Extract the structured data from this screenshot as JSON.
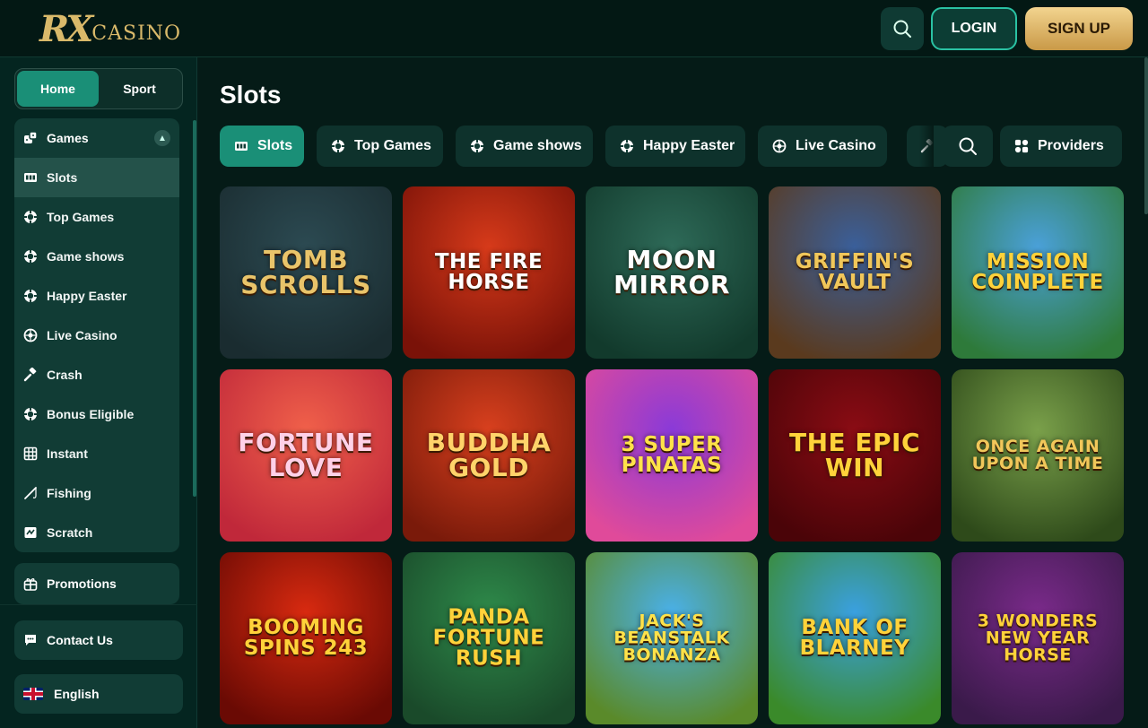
{
  "header": {
    "logo_rx": "RX",
    "logo_casino": "CASINO",
    "search_icon": "search-icon",
    "login_label": "LOGIN",
    "signup_label": "SIGN UP"
  },
  "sidebar": {
    "tabs": [
      {
        "label": "Home",
        "active": true
      },
      {
        "label": "Sport",
        "active": false
      }
    ],
    "games_section": {
      "label": "Games",
      "icon": "dice-icon",
      "expanded": true
    },
    "items": [
      {
        "label": "Slots",
        "icon": "slot-machine-icon",
        "active": true
      },
      {
        "label": "Top Games",
        "icon": "chip-icon"
      },
      {
        "label": "Game shows",
        "icon": "chip-icon"
      },
      {
        "label": "Happy Easter",
        "icon": "chip-icon"
      },
      {
        "label": "Live Casino",
        "icon": "roulette-icon"
      },
      {
        "label": "Crash",
        "icon": "hammer-icon"
      },
      {
        "label": "Bonus Eligible",
        "icon": "chip-icon"
      },
      {
        "label": "Instant",
        "icon": "grid-icon"
      },
      {
        "label": "Fishing",
        "icon": "fishing-rod-icon"
      },
      {
        "label": "Scratch",
        "icon": "scratch-icon"
      }
    ],
    "promotions_label": "Promotions",
    "contact_label": "Contact Us",
    "language_label": "English"
  },
  "main": {
    "title": "Slots",
    "chips": [
      {
        "label": "Slots",
        "icon": "slot-machine-icon",
        "active": true
      },
      {
        "label": "Top Games",
        "icon": "chip-icon"
      },
      {
        "label": "Game shows",
        "icon": "chip-icon"
      },
      {
        "label": "Happy Easter",
        "icon": "chip-icon"
      },
      {
        "label": "Live Casino",
        "icon": "roulette-icon"
      }
    ],
    "providers_label": "Providers",
    "games": [
      {
        "name": "TOMB SCROLLS",
        "bg": "#2c4a52",
        "bg2": "#1a2c30",
        "text": "#e9c46a"
      },
      {
        "name": "THE FIRE HORSE",
        "bg": "#d63a1a",
        "bg2": "#7a1208",
        "text": "#ffffff"
      },
      {
        "name": "MOON MIRROR",
        "bg": "#2e6a58",
        "bg2": "#123a2c",
        "text": "#ffffff"
      },
      {
        "name": "GRIFFIN'S VAULT",
        "bg": "#3a5f9a",
        "bg2": "#5a3a1e",
        "text": "#f1c75a"
      },
      {
        "name": "MISSION COINPLETE",
        "bg": "#4aa0d8",
        "bg2": "#2e7a3a",
        "text": "#ffd23a"
      },
      {
        "name": "FORTUNE LOVE",
        "bg": "#f0604a",
        "bg2": "#c0283a",
        "text": "#ffd1e8"
      },
      {
        "name": "BUDDHA GOLD",
        "bg": "#d8401e",
        "bg2": "#7a1a0a",
        "text": "#ffd36a"
      },
      {
        "name": "3 SUPER PINATAS",
        "bg": "#8a3ad8",
        "bg2": "#e04a9a",
        "text": "#ffe24a"
      },
      {
        "name": "THE EPIC WIN",
        "bg": "#8a0c14",
        "bg2": "#4a0408",
        "text": "#ffd23a"
      },
      {
        "name": "ONCE AGAIN UPON A TIME",
        "bg": "#7aa04a",
        "bg2": "#2e4a1a",
        "text": "#f1c75a"
      },
      {
        "name": "BOOMING SPINS 243",
        "bg": "#d82a10",
        "bg2": "#6a0a04",
        "text": "#ffd23a"
      },
      {
        "name": "PANDA FORTUNE RUSH",
        "bg": "#2e8a4a",
        "bg2": "#1a4a2a",
        "text": "#ffd23a"
      },
      {
        "name": "JACK'S BEANSTALK BONANZA",
        "bg": "#4ab0e8",
        "bg2": "#5a8a2a",
        "text": "#ffe24a"
      },
      {
        "name": "BANK OF BLARNEY",
        "bg": "#3aa0e0",
        "bg2": "#3a8a2a",
        "text": "#ffd23a"
      },
      {
        "name": "3 WONDERS NEW YEAR HORSE",
        "bg": "#7a2a8a",
        "bg2": "#3a1a4a",
        "text": "#ffd23a"
      }
    ]
  },
  "colors": {
    "accent": "#1a8f77",
    "gold": "#d9b96a",
    "bg": "#051b17"
  }
}
